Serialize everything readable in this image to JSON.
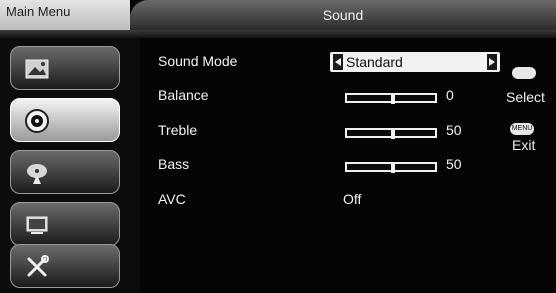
{
  "header": {
    "main_menu_label": "Main Menu",
    "title": "Sound"
  },
  "sidebar": {
    "items": [
      {
        "name": "picture",
        "icon": "picture-icon",
        "active": false
      },
      {
        "name": "sound",
        "icon": "speaker-icon",
        "active": true
      },
      {
        "name": "channel",
        "icon": "satellite-dish-icon",
        "active": false
      },
      {
        "name": "function",
        "icon": "tv-icon",
        "active": false
      },
      {
        "name": "setup",
        "icon": "tools-icon",
        "active": false
      }
    ]
  },
  "settings": {
    "sound_mode": {
      "label": "Sound Mode",
      "value": "Standard"
    },
    "balance": {
      "label": "Balance",
      "value": "0",
      "level": 0.5
    },
    "treble": {
      "label": "Treble",
      "value": "50",
      "level": 0.5
    },
    "bass": {
      "label": "Bass",
      "value": "50",
      "level": 0.5
    },
    "avc": {
      "label": "AVC",
      "value": "Off"
    }
  },
  "help": {
    "select_text": "Select",
    "exit_text": "Exit",
    "menu_key_text": "MENU"
  }
}
